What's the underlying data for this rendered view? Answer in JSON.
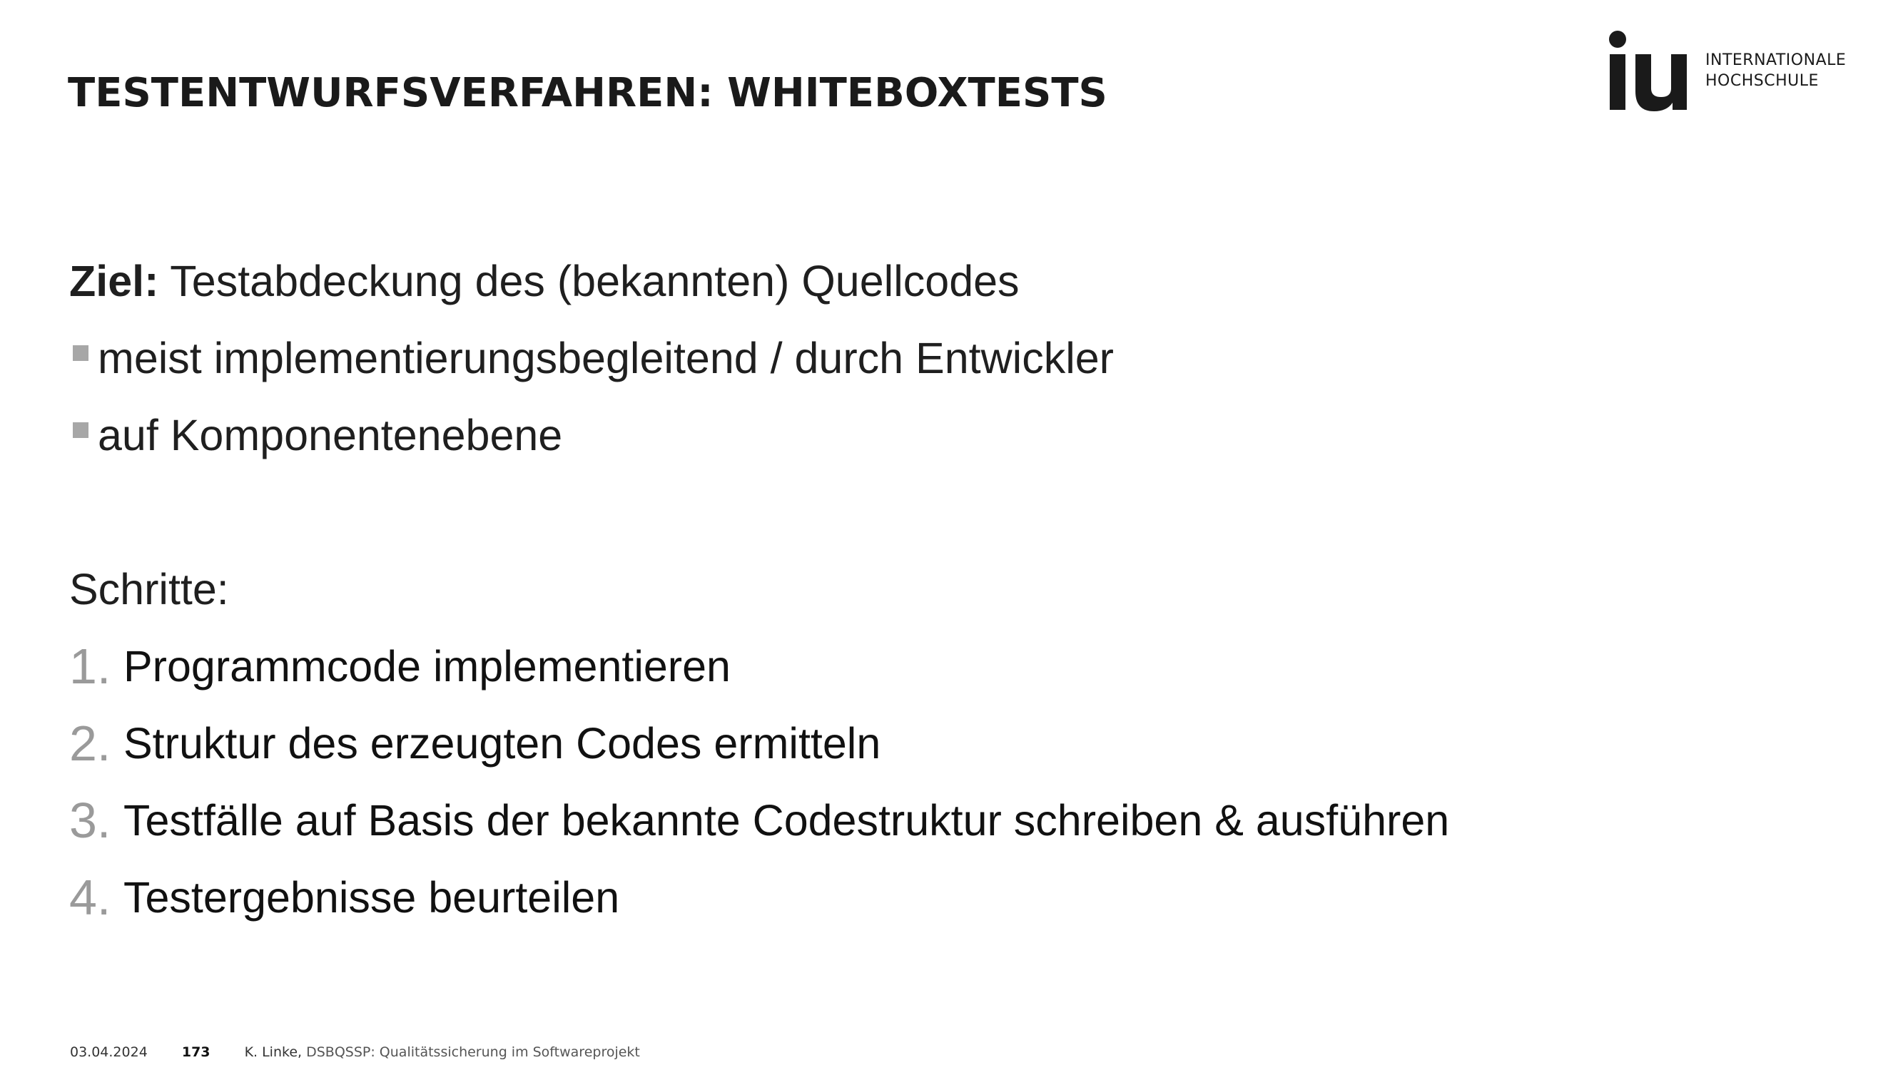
{
  "header": {
    "title": "TESTENTWURFSVERFAHREN: WHITEBOXTESTS"
  },
  "logo": {
    "mark": "iu",
    "line1": "INTERNATIONALE",
    "line2": "HOCHSCHULE",
    "icon": "iu-logo-icon"
  },
  "goal": {
    "label": "Ziel:",
    "text": "Testabdeckung des (bekannten) Quellcodes"
  },
  "bullets": [
    "meist implementierungsbegleitend / durch Entwickler",
    "auf Komponentenebene"
  ],
  "steps_heading": "Schritte:",
  "steps": [
    {
      "number": "1.",
      "text": "Programmcode implementieren"
    },
    {
      "number": "2.",
      "text": "Struktur des erzeugten Codes ermitteln"
    },
    {
      "number": "3.",
      "text": "Testfälle auf Basis der bekannte Codestruktur schreiben & ausführen"
    },
    {
      "number": "4.",
      "text": "Testergebnisse beurteilen"
    }
  ],
  "footer": {
    "date": "03.04.2024",
    "page": "173",
    "author": "K. Linke, ",
    "course": "DSBQSSP: Qualitätssicherung im Softwareprojekt"
  },
  "colors": {
    "text": "#1a1a1a",
    "bullet_marker": "#a7a7a7",
    "step_number": "#9a9a9a"
  }
}
